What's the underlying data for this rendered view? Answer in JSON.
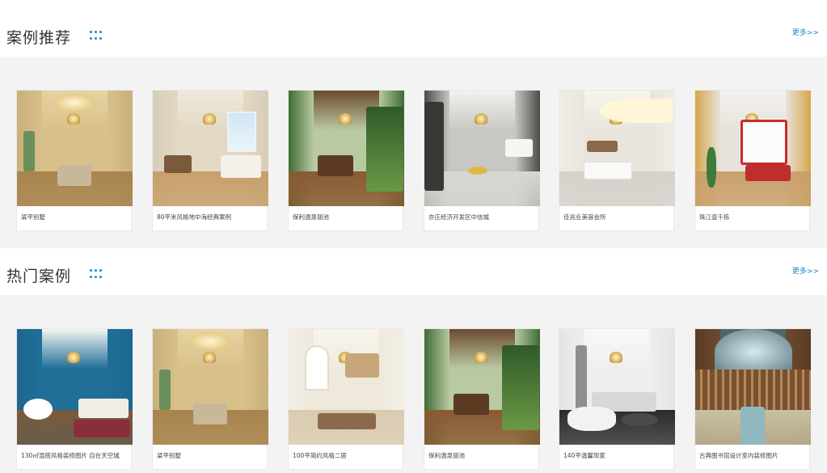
{
  "sections": [
    {
      "title": "案例推荐",
      "more_label": "更多>>",
      "cards": [
        {
          "caption": "梁平别墅",
          "theme": "gold"
        },
        {
          "caption": "80平米风格地中海经典案例",
          "theme": "beige"
        },
        {
          "caption": "保利温泉丽池",
          "theme": "green"
        },
        {
          "caption": "亦庄经济开发区中信城",
          "theme": "gray"
        },
        {
          "caption": "佳兆业美容会所",
          "theme": "white"
        },
        {
          "caption": "珠江壹千栋",
          "theme": "wood"
        }
      ]
    },
    {
      "title": "热门案例",
      "more_label": "更多>>",
      "cards": [
        {
          "caption": "130㎡混搭风格装修图片 自在天空城",
          "theme": "blue"
        },
        {
          "caption": "梁平别墅",
          "theme": "gold"
        },
        {
          "caption": "100平简约风格二居",
          "theme": "cream"
        },
        {
          "caption": "保利温泉丽池",
          "theme": "green"
        },
        {
          "caption": "140平温馨现家",
          "theme": "whitegray"
        },
        {
          "caption": "古典图书馆设计室内装修图片",
          "theme": "library"
        }
      ]
    }
  ],
  "colors": {
    "accent": "#1e88c8",
    "band": "#f3f3f3"
  }
}
